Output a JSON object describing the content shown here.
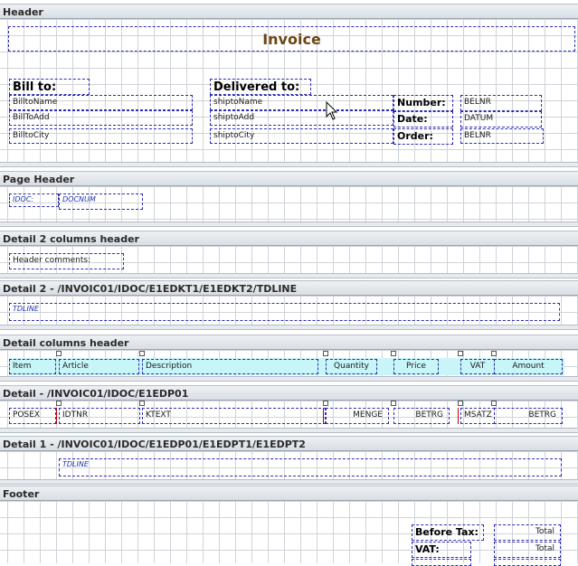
{
  "bands": {
    "header": "Header",
    "page_header": "Page Header",
    "detail2_header": "Detail 2 columns header",
    "detail2": "Detail 2 - /INVOIC01/IDOC/E1EDKT1/E1EDKT2/TDLINE",
    "detail_columns_header": "Detail columns header",
    "detail": "Detail - /INVOIC01/IDOC/E1EDP01",
    "detail1": "Detail 1 - /INVOIC01/IDOC/E1EDP01/E1EDPT1/E1EDPT2",
    "footer": "Footer"
  },
  "header": {
    "title": "Invoice",
    "bill_to_label": "Bill to:",
    "bill_to_name": "BilltoName",
    "bill_to_add": "BillToAdd",
    "bill_to_city": "BilltoCity",
    "delivered_to_label": "Delivered to:",
    "ship_to_name": "shiptoName",
    "ship_to_add": "shiptoAdd",
    "ship_to_city": "shiptoCity",
    "number_label": "Number:",
    "number_value": "BELNR",
    "date_label": "Date:",
    "date_value": "DATUM",
    "order_label": "Order:",
    "order_value": "BELNR"
  },
  "page_header": {
    "idoc": "IDOC:",
    "docnum": "DOCNUM"
  },
  "detail2_header": {
    "comments": "Header comments:"
  },
  "detail2": {
    "tdline": "TDLINE"
  },
  "columns": {
    "item": "Item",
    "article": "Article",
    "description": "Description",
    "quantity": "Quantity",
    "price": "Price",
    "vat": "VAT",
    "amount": "Amount"
  },
  "detail": {
    "posex": "POSEX",
    "idtnr": "IDTNR",
    "ktext": "KTEXT",
    "menge": "MENGE",
    "betrg1": "BETRG",
    "msatz": "MSATZ",
    "betrg2": "BETRG"
  },
  "detail1": {
    "tdline": "TDLINE"
  },
  "footer": {
    "before_tax_label": "Before Tax:",
    "before_tax_value": "Total",
    "vat_label": "VAT:",
    "vat_value": "Total"
  }
}
